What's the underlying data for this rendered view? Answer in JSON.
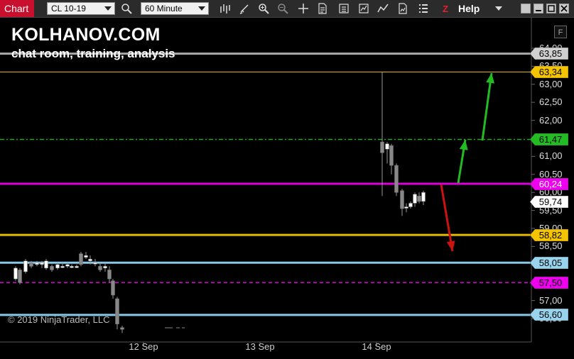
{
  "toolbar": {
    "tab_label": "Chart",
    "instrument": "CL 10-19",
    "interval": "60 Minute",
    "help_label": "Help",
    "icons": [
      "search-icon",
      "bar-type-icon",
      "pencil-icon",
      "zoom-in-icon",
      "zoom-out-icon",
      "crosshair-icon",
      "data-box-icon",
      "properties-icon",
      "chart-style-icon",
      "indicators-icon",
      "strategies-icon",
      "trade-icon"
    ]
  },
  "chart": {
    "title": "KOLHANOV.COM",
    "subtitle": "chat room, training, analysis",
    "copyright": "© 2019 NinjaTrader, LLC",
    "f_button": "F",
    "price_axis": [
      "64,00",
      "63,50",
      "63,00",
      "62,50",
      "62,00",
      "61,50",
      "61,00",
      "60,50",
      "60,00",
      "59,50",
      "59,00",
      "58,50",
      "58,00",
      "57,50",
      "57,00",
      "56,50"
    ],
    "x_axis": [
      "12 Sep",
      "13 Sep",
      "14 Sep"
    ],
    "levels": [
      {
        "label": "63,85",
        "price": 63.85,
        "line_color": "#aaaaaa",
        "tag_bg": "#d0d0d0",
        "tag_text": "#000000",
        "style": "solid-thick"
      },
      {
        "label": "63,34",
        "price": 63.34,
        "line_color": "#e6b800",
        "tag_bg": "#f5c400",
        "tag_text": "#000000",
        "style": "solid-thin"
      },
      {
        "label": "61,47",
        "price": 61.47,
        "line_color": "#22aa22",
        "tag_bg": "#22bb22",
        "tag_text": "#000000",
        "style": "dashdot"
      },
      {
        "label": "60,24",
        "price": 60.24,
        "line_color": "#dd00dd",
        "tag_bg": "#ee00ee",
        "tag_text": "#ffffff",
        "style": "solid-thick"
      },
      {
        "label": "59,74",
        "price": 59.74,
        "line_color": "#000000",
        "tag_bg": "#ffffff",
        "tag_text": "#000000",
        "style": "none"
      },
      {
        "label": "58,82",
        "price": 58.82,
        "line_color": "#e6b800",
        "tag_bg": "#f5c400",
        "tag_text": "#000000",
        "style": "solid-thick"
      },
      {
        "label": "58,05",
        "price": 58.05,
        "line_color": "#88c8e8",
        "tag_bg": "#99d4ee",
        "tag_text": "#000000",
        "style": "solid-thick"
      },
      {
        "label": "57,50",
        "price": 57.5,
        "line_color": "#dd00dd",
        "tag_bg": "#ee00ee",
        "tag_text": "#000000",
        "style": "dashed"
      },
      {
        "label": "56,60",
        "price": 56.6,
        "line_color": "#88c8e8",
        "tag_bg": "#99d4ee",
        "tag_text": "#000000",
        "style": "solid-thick"
      }
    ],
    "colors": {
      "background": "#000000",
      "bull_candle": "#ffffff",
      "bear_candle": "#888888",
      "arrow_up": "#22bb22",
      "arrow_down": "#cc1111"
    }
  }
}
